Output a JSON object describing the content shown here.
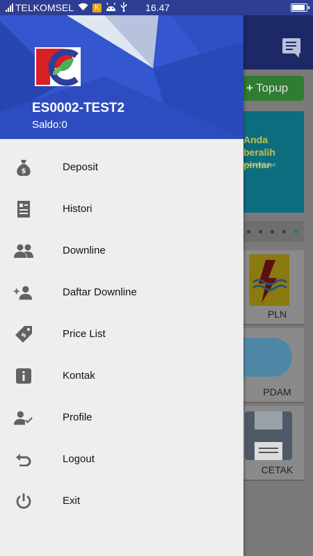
{
  "status_bar": {
    "carrier": "TELKOMSEL",
    "badge": "K",
    "time": "16.47"
  },
  "drawer": {
    "header": {
      "user_id": "ES0002-TEST2",
      "saldo": "Saldo:0"
    },
    "menu": [
      {
        "label": "Deposit",
        "icon": "money-bag-icon"
      },
      {
        "label": "Histori",
        "icon": "document-list-icon"
      },
      {
        "label": "Downline",
        "icon": "people-icon"
      },
      {
        "label": "Daftar Downline",
        "icon": "person-add-icon"
      },
      {
        "label": "Price List",
        "icon": "price-tag-icon"
      },
      {
        "label": "Kontak",
        "icon": "info-icon"
      },
      {
        "label": "Profile",
        "icon": "person-check-icon"
      },
      {
        "label": "Logout",
        "icon": "undo-arrow-icon"
      },
      {
        "label": "Exit",
        "icon": "power-icon"
      }
    ]
  },
  "background_app": {
    "topup_label": "Topup",
    "banner_text": "Anda beralih pintar",
    "banner_subtext": "ar sekarang juga!",
    "tiles": [
      "PLN",
      "PDAM",
      "CETAK"
    ]
  },
  "colors": {
    "header_blue": "#2f4fc4",
    "drawer_bg": "#eeeeee",
    "icon_gray": "#616161"
  }
}
